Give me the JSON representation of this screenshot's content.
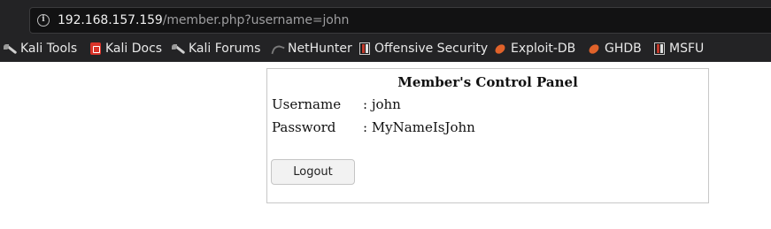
{
  "browser": {
    "url_host": "192.168.157.159",
    "url_path": "/member.php?username=john",
    "bookmarks": [
      {
        "label": "Kali Tools",
        "icon": "kali-dragon-icon"
      },
      {
        "label": "Kali Docs",
        "icon": "kali-docs-icon"
      },
      {
        "label": "Kali Forums",
        "icon": "kali-dragon-icon"
      },
      {
        "label": "NetHunter",
        "icon": "nethunter-icon"
      },
      {
        "label": "Offensive Security",
        "icon": "offsec-icon"
      },
      {
        "label": "Exploit-DB",
        "icon": "exploit-db-icon"
      },
      {
        "label": "GHDB",
        "icon": "exploit-db-icon"
      },
      {
        "label": "MSFU",
        "icon": "offsec-icon"
      }
    ]
  },
  "panel": {
    "title": "Member's Control Panel",
    "fields": [
      {
        "label": "Username",
        "value": ": john"
      },
      {
        "label": "Password",
        "value": ": MyNameIsJohn"
      }
    ],
    "logout_label": "Logout"
  }
}
